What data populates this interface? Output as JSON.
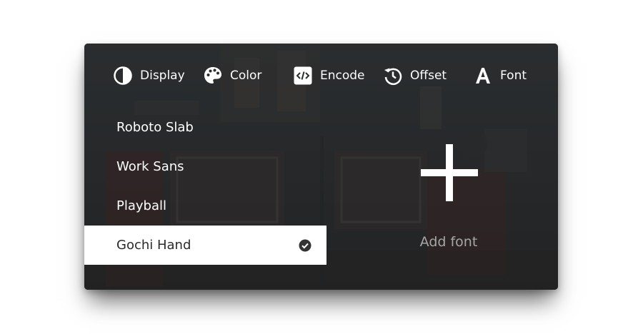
{
  "toolbar": {
    "tabs": [
      {
        "label": "Display",
        "icon": "contrast-icon"
      },
      {
        "label": "Color",
        "icon": "palette-icon"
      },
      {
        "label": "Encode",
        "icon": "code-icon"
      },
      {
        "label": "Offset",
        "icon": "history-icon"
      },
      {
        "label": "Font",
        "icon": "font-icon"
      }
    ]
  },
  "font_list": {
    "items": [
      {
        "label": "Roboto Slab",
        "selected": false
      },
      {
        "label": "Work Sans",
        "selected": false
      },
      {
        "label": "Playball",
        "selected": false
      },
      {
        "label": "Gochi Hand",
        "selected": true
      }
    ]
  },
  "add_font": {
    "label": "Add font"
  },
  "colors": {
    "overlay": "#2a2d2f",
    "selected_bg": "#ffffff",
    "text": "#ffffff",
    "muted_text": "#a6a6a6"
  }
}
